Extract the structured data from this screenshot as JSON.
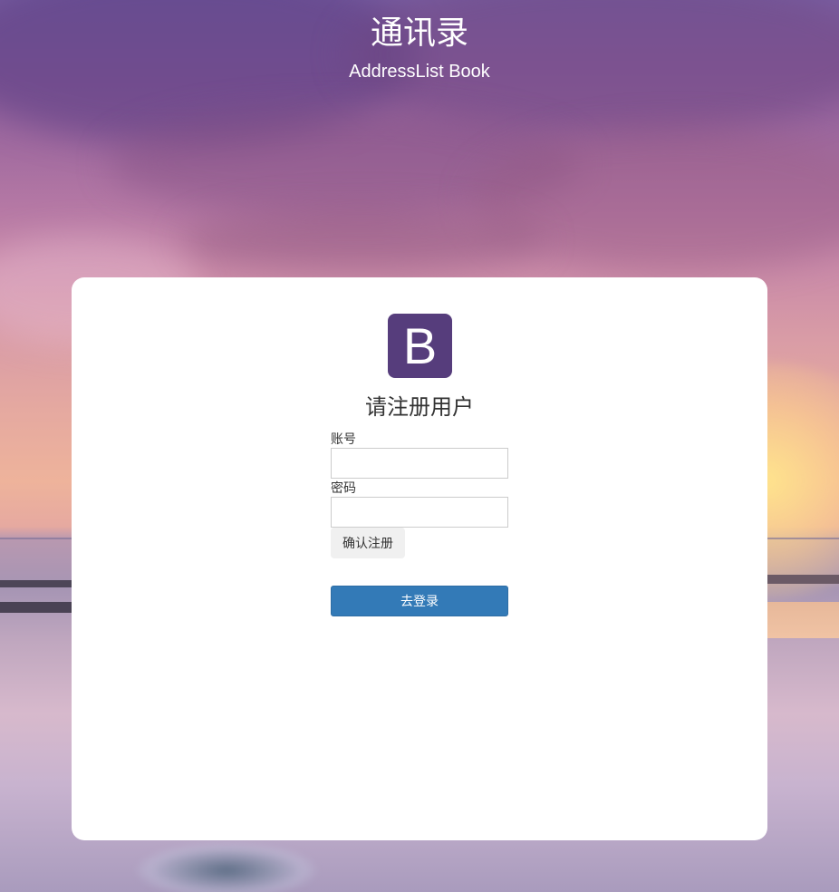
{
  "header": {
    "title": "通讯录",
    "subtitle": "AddressList Book"
  },
  "logo": {
    "letter": "B",
    "color": "#563d7c"
  },
  "form": {
    "title": "请注册用户",
    "account_label": "账号",
    "account_value": "",
    "password_label": "密码",
    "password_value": "",
    "register_button": "确认注册",
    "login_button": "去登录"
  },
  "colors": {
    "primary": "#337ab7",
    "card_background": "#ffffff"
  }
}
